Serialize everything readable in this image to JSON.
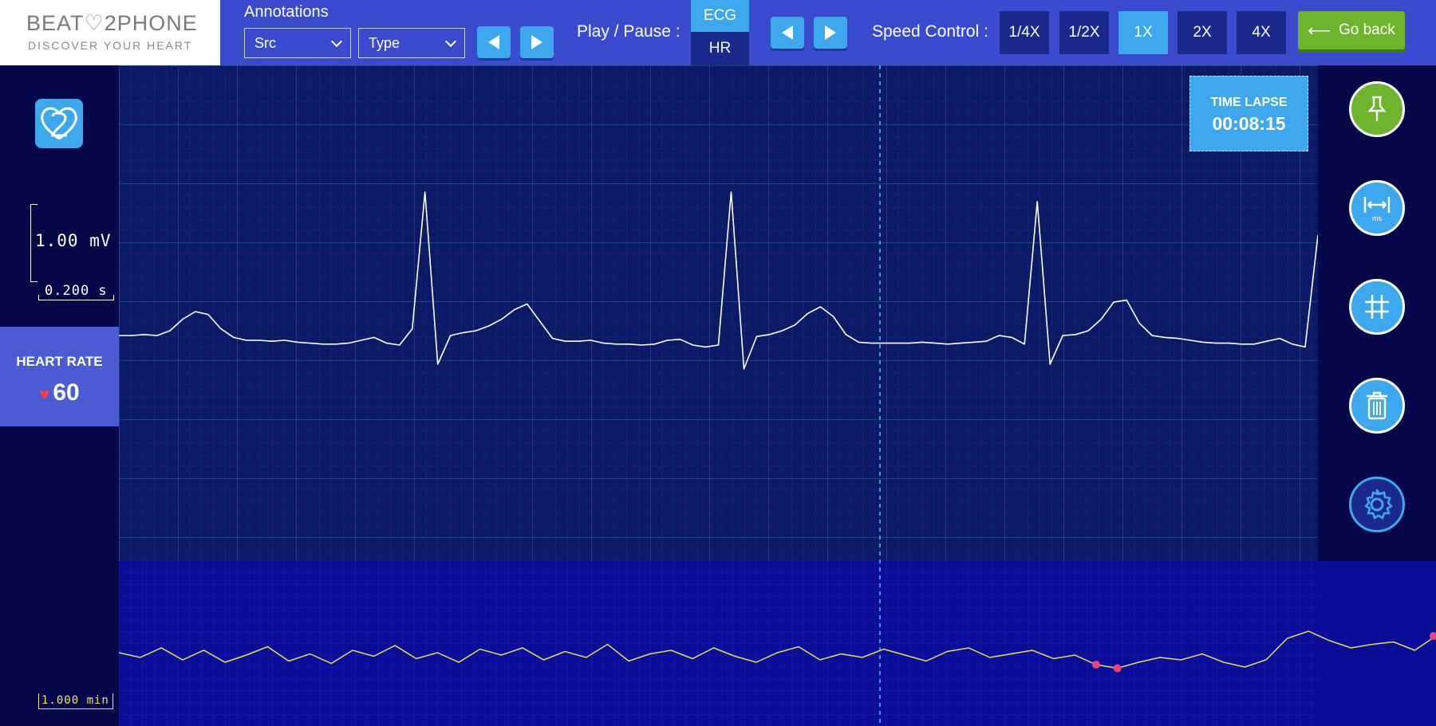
{
  "logo": {
    "title_a": "BEAT",
    "title_heart": "♡",
    "title_b": "2PHONE",
    "subtitle": "DISCOVER YOUR HEART"
  },
  "annotations": {
    "label": "Annotations",
    "src_select": "Src",
    "type_select": "Type"
  },
  "playback": {
    "label": "Play / Pause :",
    "ecg": "ECG",
    "hr": "HR"
  },
  "speed": {
    "label": "Speed Control :",
    "options": [
      "1/4X",
      "1/2X",
      "1X",
      "2X",
      "4X"
    ],
    "selected": "1X"
  },
  "go_back": "Go back",
  "scale": {
    "voltage": "1.00 mV",
    "time": "0.200 s",
    "hr_window": "1.000 min"
  },
  "heart_rate": {
    "title": "HEART RATE",
    "value": "60"
  },
  "time_lapse": {
    "title": "TIME LAPSE",
    "value": "00:08:15"
  },
  "side_tools": {
    "pin": "pin-icon",
    "measure": "ms",
    "grid": "grid-icon",
    "delete": "trash-icon",
    "settings": "gear-icon"
  },
  "colors": {
    "topbar": "#3b4bd0",
    "accent": "#3ea8ee",
    "dark_btn": "#1a2a8c",
    "go_back": "#6cb52d",
    "ecg_bg": "#0b1a66",
    "hr_bg": "#0a0c9a",
    "ecg_line": "#ffffff",
    "hr_line": "#e8e04a",
    "marker": "#e8457a"
  },
  "chart_data": {
    "type": "line",
    "series": [
      {
        "values": [
          0.05,
          0.05,
          0.06,
          0.05,
          0.1,
          0.22,
          0.3,
          0.27,
          0.12,
          0.03,
          0.0,
          0.0,
          -0.01,
          0.0,
          -0.02,
          -0.03,
          -0.04,
          -0.04,
          -0.03,
          0.0,
          0.03,
          -0.03,
          -0.05,
          0.12,
          1.55,
          -0.25,
          0.05,
          0.08,
          0.1,
          0.15,
          0.22,
          0.32,
          0.38,
          0.2,
          0.02,
          -0.01,
          -0.01,
          0.0,
          -0.03,
          -0.04,
          -0.04,
          -0.05,
          -0.04,
          0.0,
          0.01,
          -0.05,
          -0.07,
          -0.05,
          1.55,
          -0.3,
          0.04,
          0.06,
          0.1,
          0.16,
          0.28,
          0.35,
          0.25,
          0.06,
          -0.02,
          -0.03,
          -0.03,
          -0.03,
          -0.03,
          -0.02,
          -0.03,
          -0.04,
          -0.03,
          -0.02,
          -0.01,
          0.05,
          0.03,
          -0.04,
          1.45,
          -0.25,
          0.05,
          0.06,
          0.1,
          0.22,
          0.4,
          0.42,
          0.18,
          0.05,
          0.03,
          0.02,
          0.0,
          -0.02,
          -0.03,
          -0.03,
          -0.04,
          -0.04,
          -0.01,
          0.02,
          -0.04,
          -0.07,
          1.1
        ]
      },
      {
        "values": [
          0.48,
          0.44,
          0.52,
          0.42,
          0.5,
          0.4,
          0.46,
          0.53,
          0.41,
          0.47,
          0.39,
          0.5,
          0.45,
          0.54,
          0.43,
          0.48,
          0.4,
          0.51,
          0.46,
          0.52,
          0.42,
          0.49,
          0.44,
          0.55,
          0.41,
          0.47,
          0.5,
          0.43,
          0.52,
          0.45,
          0.4,
          0.48,
          0.53,
          0.42,
          0.47,
          0.44,
          0.51,
          0.46,
          0.41,
          0.49,
          0.52,
          0.44,
          0.47,
          0.5,
          0.43,
          0.46,
          0.38,
          0.35,
          0.4,
          0.44,
          0.42,
          0.47,
          0.4,
          0.36,
          0.42,
          0.6,
          0.66,
          0.58,
          0.52,
          0.55,
          0.57,
          0.5,
          0.62
        ]
      }
    ],
    "markers_hr_index": [
      46,
      47
    ]
  }
}
